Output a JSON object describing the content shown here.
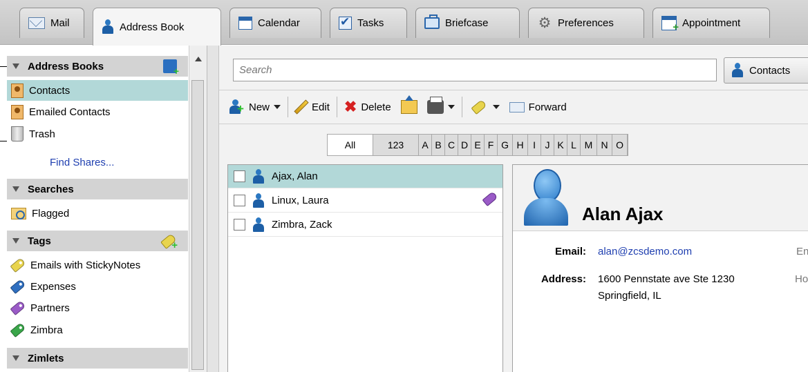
{
  "tabs": [
    {
      "label": "Mail",
      "icon": "mail-icon"
    },
    {
      "label": "Address Book",
      "icon": "person-icon"
    },
    {
      "label": "Calendar",
      "icon": "calendar-icon"
    },
    {
      "label": "Tasks",
      "icon": "tasks-check-icon"
    },
    {
      "label": "Briefcase",
      "icon": "briefcase-icon"
    },
    {
      "label": "Preferences",
      "icon": "gear-icon"
    },
    {
      "label": "Appointment",
      "icon": "appointment-icon"
    }
  ],
  "sidebar": {
    "address_books": {
      "header": "Address Books",
      "items": [
        "Contacts",
        "Emailed Contacts",
        "Trash"
      ],
      "find_shares": "Find Shares..."
    },
    "searches": {
      "header": "Searches",
      "items": [
        "Flagged"
      ]
    },
    "tags": {
      "header": "Tags",
      "items": [
        {
          "label": "Emails with StickyNotes",
          "color": "#e8d44d"
        },
        {
          "label": "Expenses",
          "color": "#2f6fc0"
        },
        {
          "label": "Partners",
          "color": "#9a5bc7"
        },
        {
          "label": "Zimbra",
          "color": "#3aa64a"
        }
      ]
    },
    "zimlets": {
      "header": "Zimlets"
    }
  },
  "search": {
    "placeholder": "Search",
    "scope": "Contacts"
  },
  "toolbar": {
    "new_label": "New",
    "edit_label": "Edit",
    "delete_label": "Delete",
    "forward_label": "Forward"
  },
  "alphabet": [
    "All",
    "123",
    "A",
    "B",
    "C",
    "D",
    "E",
    "F",
    "G",
    "H",
    "I",
    "J",
    "K",
    "L",
    "M",
    "N",
    "O"
  ],
  "contacts": [
    {
      "name": "Ajax, Alan",
      "selected": true
    },
    {
      "name": "Linux, Laura",
      "tag_color": "#9a5bc7"
    },
    {
      "name": "Zimbra, Zack"
    }
  ],
  "detail": {
    "full_name": "Alan Ajax",
    "email_label": "Email:",
    "email": "alan@zcsdemo.com",
    "address_label": "Address:",
    "address_line1": "1600 Pennstate ave Ste 1230",
    "address_line2": "Springfield, IL",
    "cut_label_1": "En",
    "cut_label_2": "Ho"
  },
  "colors": {
    "selection": "#b2d8d8",
    "link": "#1f3fb0"
  }
}
